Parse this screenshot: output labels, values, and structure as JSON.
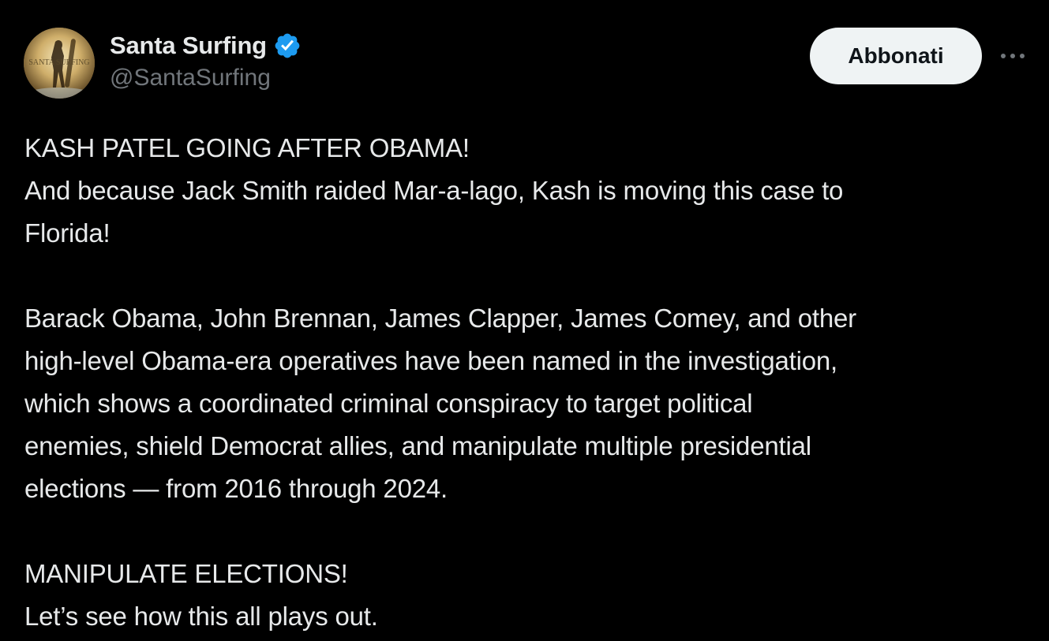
{
  "author": {
    "display_name": "Santa Surfing",
    "handle": "@SantaSurfing",
    "avatar_text": "SANTA SURFING",
    "verified_icon": "verified-badge-icon"
  },
  "actions": {
    "subscribe_label": "Abbonati",
    "more_icon": "more-options-icon"
  },
  "colors": {
    "background": "#000000",
    "text": "#e7e9ea",
    "secondary_text": "#71767b",
    "verified_blue": "#1d9bf0",
    "button_bg": "#eff3f4"
  },
  "post": {
    "lines": [
      "KASH PATEL GOING AFTER OBAMA!",
      "And because Jack Smith raided Mar-a-lago, Kash is moving this case to",
      "Florida!",
      "Barack Obama, John Brennan, James Clapper, James Comey, and other",
      "high-level Obama-era operatives have been named in the investigation,",
      "which shows a coordinated criminal conspiracy to target political",
      "enemies, shield Democrat allies, and manipulate multiple presidential",
      "elections — from 2016 through 2024.",
      "MANIPULATE ELECTIONS!",
      "Let’s see how this all plays out."
    ]
  }
}
